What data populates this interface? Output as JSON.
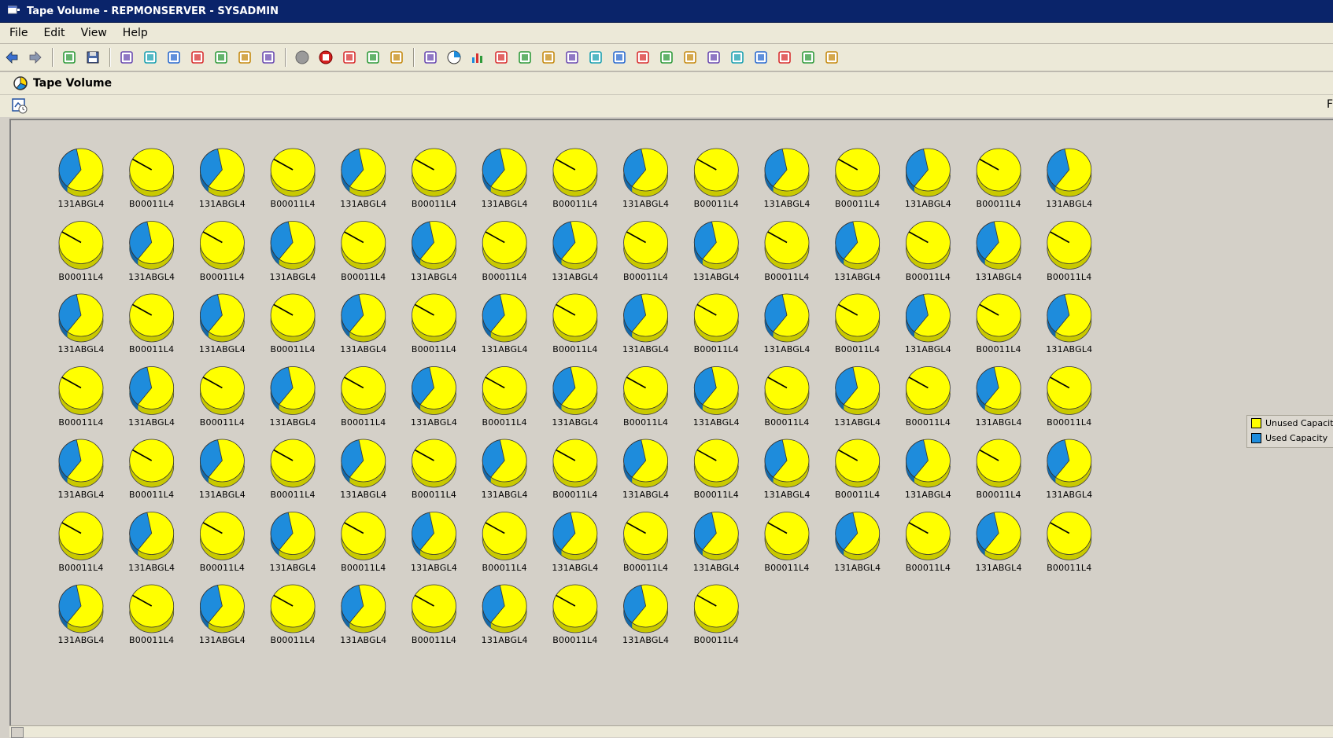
{
  "window": {
    "title": "Tape Volume - REPMONSERVER - SYSADMIN"
  },
  "menu": {
    "items": [
      "File",
      "Edit",
      "View",
      "Help"
    ]
  },
  "toolbar": {
    "icons": [
      "back-arrow-icon",
      "forward-arrow-icon",
      "new-window-icon",
      "save-icon",
      "grid-view-icon",
      "calendar-icon",
      "filter-icon",
      "move-icon",
      "users-icon",
      "help-icon",
      "layers-icon",
      "record-gray-icon",
      "stop-icon",
      "refresh-icon",
      "home-icon",
      "speaker-icon",
      "table-icon",
      "pie-chart-icon",
      "bar-chart-icon",
      "line-chart-icon",
      "edit-icon",
      "gauge-icon",
      "monitor-icon",
      "text-icon",
      "notes-icon",
      "image-icon",
      "comment-icon",
      "globe-icon",
      "list-icon",
      "report-icon",
      "target-icon",
      "hierarchy-icon",
      "grid-table-icon",
      "palette-icon"
    ]
  },
  "panel": {
    "title": "Tape Volume",
    "edge_text": "F"
  },
  "colors": {
    "unused": "#ffff00",
    "used": "#1e8cdc",
    "unused_side": "#c9c900",
    "used_side": "#1468a8"
  },
  "legend": {
    "items": [
      {
        "label": "Unused Capacity",
        "color": "#ffff00"
      },
      {
        "label": "Used Capacity",
        "color": "#1e8cdc"
      }
    ]
  },
  "chart_data": {
    "type": "pie",
    "layout": "grid",
    "columns": 15,
    "series_names": [
      "Unused Capacity",
      "Used Capacity"
    ],
    "volumes": [
      {
        "label": "131ABGL4",
        "used_pct": 36
      },
      {
        "label": "B00011L4",
        "used_pct": 0
      },
      {
        "label": "131ABGL4",
        "used_pct": 36
      },
      {
        "label": "B00011L4",
        "used_pct": 0
      },
      {
        "label": "131ABGL4",
        "used_pct": 36
      },
      {
        "label": "B00011L4",
        "used_pct": 0
      },
      {
        "label": "131ABGL4",
        "used_pct": 36
      },
      {
        "label": "B00011L4",
        "used_pct": 0
      },
      {
        "label": "131ABGL4",
        "used_pct": 36
      },
      {
        "label": "B00011L4",
        "used_pct": 0
      },
      {
        "label": "131ABGL4",
        "used_pct": 36
      },
      {
        "label": "B00011L4",
        "used_pct": 0
      },
      {
        "label": "131ABGL4",
        "used_pct": 36
      },
      {
        "label": "B00011L4",
        "used_pct": 0
      },
      {
        "label": "131ABGL4",
        "used_pct": 36
      },
      {
        "label": "B00011L4",
        "used_pct": 0
      },
      {
        "label": "131ABGL4",
        "used_pct": 36
      },
      {
        "label": "B00011L4",
        "used_pct": 0
      },
      {
        "label": "131ABGL4",
        "used_pct": 36
      },
      {
        "label": "B00011L4",
        "used_pct": 0
      },
      {
        "label": "131ABGL4",
        "used_pct": 36
      },
      {
        "label": "B00011L4",
        "used_pct": 0
      },
      {
        "label": "131ABGL4",
        "used_pct": 36
      },
      {
        "label": "B00011L4",
        "used_pct": 0
      },
      {
        "label": "131ABGL4",
        "used_pct": 36
      },
      {
        "label": "B00011L4",
        "used_pct": 0
      },
      {
        "label": "131ABGL4",
        "used_pct": 36
      },
      {
        "label": "B00011L4",
        "used_pct": 0
      },
      {
        "label": "131ABGL4",
        "used_pct": 36
      },
      {
        "label": "B00011L4",
        "used_pct": 0
      },
      {
        "label": "131ABGL4",
        "used_pct": 36
      },
      {
        "label": "B00011L4",
        "used_pct": 0
      },
      {
        "label": "131ABGL4",
        "used_pct": 36
      },
      {
        "label": "B00011L4",
        "used_pct": 0
      },
      {
        "label": "131ABGL4",
        "used_pct": 36
      },
      {
        "label": "B00011L4",
        "used_pct": 0
      },
      {
        "label": "131ABGL4",
        "used_pct": 36
      },
      {
        "label": "B00011L4",
        "used_pct": 0
      },
      {
        "label": "131ABGL4",
        "used_pct": 36
      },
      {
        "label": "B00011L4",
        "used_pct": 0
      },
      {
        "label": "131ABGL4",
        "used_pct": 36
      },
      {
        "label": "B00011L4",
        "used_pct": 0
      },
      {
        "label": "131ABGL4",
        "used_pct": 36
      },
      {
        "label": "B00011L4",
        "used_pct": 0
      },
      {
        "label": "131ABGL4",
        "used_pct": 36
      },
      {
        "label": "B00011L4",
        "used_pct": 0
      },
      {
        "label": "131ABGL4",
        "used_pct": 36
      },
      {
        "label": "B00011L4",
        "used_pct": 0
      },
      {
        "label": "131ABGL4",
        "used_pct": 36
      },
      {
        "label": "B00011L4",
        "used_pct": 0
      },
      {
        "label": "131ABGL4",
        "used_pct": 36
      },
      {
        "label": "B00011L4",
        "used_pct": 0
      },
      {
        "label": "131ABGL4",
        "used_pct": 36
      },
      {
        "label": "B00011L4",
        "used_pct": 0
      },
      {
        "label": "131ABGL4",
        "used_pct": 36
      },
      {
        "label": "B00011L4",
        "used_pct": 0
      },
      {
        "label": "131ABGL4",
        "used_pct": 36
      },
      {
        "label": "B00011L4",
        "used_pct": 0
      },
      {
        "label": "131ABGL4",
        "used_pct": 36
      },
      {
        "label": "B00011L4",
        "used_pct": 0
      },
      {
        "label": "131ABGL4",
        "used_pct": 36
      },
      {
        "label": "B00011L4",
        "used_pct": 0
      },
      {
        "label": "131ABGL4",
        "used_pct": 36
      },
      {
        "label": "B00011L4",
        "used_pct": 0
      },
      {
        "label": "131ABGL4",
        "used_pct": 36
      },
      {
        "label": "B00011L4",
        "used_pct": 0
      },
      {
        "label": "131ABGL4",
        "used_pct": 36
      },
      {
        "label": "B00011L4",
        "used_pct": 0
      },
      {
        "label": "131ABGL4",
        "used_pct": 36
      },
      {
        "label": "B00011L4",
        "used_pct": 0
      },
      {
        "label": "131ABGL4",
        "used_pct": 36
      },
      {
        "label": "B00011L4",
        "used_pct": 0
      },
      {
        "label": "131ABGL4",
        "used_pct": 36
      },
      {
        "label": "B00011L4",
        "used_pct": 0
      },
      {
        "label": "131ABGL4",
        "used_pct": 36
      },
      {
        "label": "B00011L4",
        "used_pct": 0
      },
      {
        "label": "131ABGL4",
        "used_pct": 36
      },
      {
        "label": "B00011L4",
        "used_pct": 0
      },
      {
        "label": "131ABGL4",
        "used_pct": 36
      },
      {
        "label": "B00011L4",
        "used_pct": 0
      },
      {
        "label": "131ABGL4",
        "used_pct": 36
      },
      {
        "label": "B00011L4",
        "used_pct": 0
      },
      {
        "label": "131ABGL4",
        "used_pct": 36
      },
      {
        "label": "B00011L4",
        "used_pct": 0
      },
      {
        "label": "131ABGL4",
        "used_pct": 36
      },
      {
        "label": "B00011L4",
        "used_pct": 0
      },
      {
        "label": "131ABGL4",
        "used_pct": 36
      },
      {
        "label": "B00011L4",
        "used_pct": 0
      },
      {
        "label": "131ABGL4",
        "used_pct": 36
      },
      {
        "label": "B00011L4",
        "used_pct": 0
      },
      {
        "label": "131ABGL4",
        "used_pct": 36
      },
      {
        "label": "B00011L4",
        "used_pct": 0
      },
      {
        "label": "131ABGL4",
        "used_pct": 36
      },
      {
        "label": "B00011L4",
        "used_pct": 0
      },
      {
        "label": "131ABGL4",
        "used_pct": 36
      },
      {
        "label": "B00011L4",
        "used_pct": 0
      },
      {
        "label": "131ABGL4",
        "used_pct": 36
      },
      {
        "label": "B00011L4",
        "used_pct": 0
      },
      {
        "label": "131ABGL4",
        "used_pct": 36
      },
      {
        "label": "B00011L4",
        "used_pct": 0
      }
    ]
  }
}
